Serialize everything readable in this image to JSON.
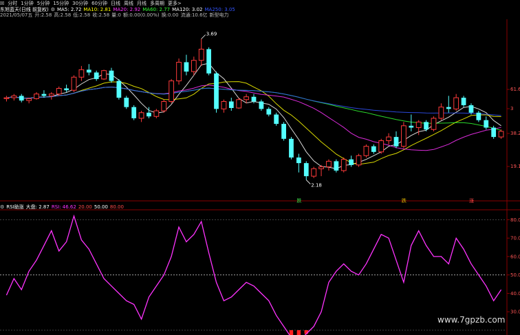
{
  "toolbar": {
    "items": [
      "分时",
      "1分钟",
      "5分钟",
      "15分钟",
      "30分钟",
      "60分钟",
      "日线",
      "周线",
      "月线",
      "多周期",
      "更多>"
    ]
  },
  "legend": {
    "title": "东旭蓝天(日线 前复权)",
    "ma5": "MA5: 2.72",
    "ma10": "MA10: 2.81",
    "ma20": "MA20: 2.92",
    "ma60": "MA60: 2.77",
    "ma120": "MA120: 3.02",
    "ma250": "MA250: 3.05"
  },
  "info": {
    "date": "2021/05/07五",
    "open": "开:2.58",
    "high": "高:2.58",
    "low": "低:2.58",
    "close": "收:2.58",
    "volume": "量:0",
    "amount": "额:0.00(0.00%)",
    "turnover": "换:0.00",
    "float_cap": "流通:10.6亿",
    "concept": "新型电力"
  },
  "annotations": {
    "high": "3.69",
    "low": "2.18"
  },
  "markers": [
    {
      "text": "跌",
      "color": "#3ee04a"
    },
    {
      "text": "跌",
      "color": "#e6b800"
    },
    {
      "text": "涨",
      "color": "#ff4a4a"
    }
  ],
  "price_axis": {
    "labels": [
      "61.6",
      "3",
      "38.2",
      "19.1"
    ]
  },
  "sub_legend": {
    "name": "RSI助涨",
    "market": "大盘: 2.87",
    "rsi": "RSI: 46.62",
    "l20": "20.00",
    "l50": "50.00",
    "l80": "80.00"
  },
  "rsi_axis": {
    "labels": [
      "80.0",
      "70.0",
      "60.0",
      "50.0",
      "40.0",
      "30.0"
    ]
  },
  "colors": {
    "ma5": "#ffffff",
    "ma10": "#ffff00",
    "ma20": "#ff33ff",
    "ma60": "#33ff33",
    "ma120": "#3355ff",
    "ma250": "#ffffff",
    "up": "#ff3b3b",
    "down": "#54ffff",
    "rsi": "#ff33ff",
    "fill": "#ff2020",
    "axis": "#8a0000"
  },
  "watermark": "www.7gpzb.com",
  "chart_data": [
    {
      "type": "candlestick",
      "ylim": [
        2.0,
        3.9
      ],
      "ma_series": [
        "MA5",
        "MA10",
        "MA20",
        "MA60",
        "MA120",
        "MA250"
      ],
      "candles": [
        [
          3.05,
          3.08,
          3.02,
          3.06
        ],
        [
          3.06,
          3.1,
          3.03,
          3.08
        ],
        [
          3.08,
          3.1,
          3.01,
          3.03
        ],
        [
          3.03,
          3.06,
          3.0,
          3.05
        ],
        [
          3.05,
          3.12,
          3.04,
          3.1
        ],
        [
          3.1,
          3.14,
          3.06,
          3.08
        ],
        [
          3.08,
          3.12,
          3.04,
          3.1
        ],
        [
          3.1,
          3.18,
          3.08,
          3.16
        ],
        [
          3.16,
          3.2,
          3.12,
          3.14
        ],
        [
          3.14,
          3.3,
          3.12,
          3.28
        ],
        [
          3.28,
          3.4,
          3.24,
          3.36
        ],
        [
          3.36,
          3.42,
          3.3,
          3.33
        ],
        [
          3.33,
          3.35,
          3.24,
          3.26
        ],
        [
          3.26,
          3.36,
          3.25,
          3.35
        ],
        [
          3.35,
          3.38,
          3.22,
          3.24
        ],
        [
          3.24,
          3.26,
          3.04,
          3.06
        ],
        [
          3.06,
          3.08,
          2.94,
          2.96
        ],
        [
          2.96,
          2.98,
          2.82,
          2.84
        ],
        [
          2.84,
          2.92,
          2.8,
          2.9
        ],
        [
          2.9,
          2.96,
          2.84,
          2.86
        ],
        [
          2.86,
          2.94,
          2.84,
          2.92
        ],
        [
          2.92,
          3.04,
          2.9,
          3.02
        ],
        [
          3.02,
          3.26,
          3.0,
          3.24
        ],
        [
          3.24,
          3.48,
          3.2,
          3.44
        ],
        [
          3.44,
          3.52,
          3.3,
          3.34
        ],
        [
          3.34,
          3.5,
          3.3,
          3.46
        ],
        [
          3.46,
          3.69,
          3.4,
          3.58
        ],
        [
          3.58,
          3.6,
          3.3,
          3.32
        ],
        [
          3.32,
          3.34,
          2.9,
          2.94
        ],
        [
          2.94,
          3.04,
          2.9,
          3.02
        ],
        [
          3.02,
          3.06,
          2.92,
          2.95
        ],
        [
          2.95,
          3.06,
          2.94,
          3.04
        ],
        [
          3.04,
          3.1,
          3.0,
          3.07
        ],
        [
          3.07,
          3.1,
          3.0,
          3.02
        ],
        [
          3.02,
          3.04,
          2.92,
          2.94
        ],
        [
          2.94,
          2.96,
          2.86,
          2.88
        ],
        [
          2.88,
          2.9,
          2.76,
          2.78
        ],
        [
          2.78,
          2.8,
          2.6,
          2.62
        ],
        [
          2.62,
          2.64,
          2.4,
          2.42
        ],
        [
          2.42,
          2.46,
          2.26,
          2.36
        ],
        [
          2.36,
          2.38,
          2.18,
          2.22
        ],
        [
          2.22,
          2.32,
          2.2,
          2.3
        ],
        [
          2.3,
          2.34,
          2.22,
          2.32
        ],
        [
          2.32,
          2.4,
          2.28,
          2.38
        ],
        [
          2.38,
          2.4,
          2.26,
          2.28
        ],
        [
          2.28,
          2.42,
          2.26,
          2.4
        ],
        [
          2.4,
          2.44,
          2.32,
          2.34
        ],
        [
          2.34,
          2.46,
          2.32,
          2.44
        ],
        [
          2.44,
          2.56,
          2.42,
          2.54
        ],
        [
          2.54,
          2.56,
          2.46,
          2.48
        ],
        [
          2.48,
          2.62,
          2.46,
          2.6
        ],
        [
          2.6,
          2.68,
          2.56,
          2.64
        ],
        [
          2.64,
          2.7,
          2.52,
          2.54
        ],
        [
          2.54,
          2.8,
          2.52,
          2.76
        ],
        [
          2.76,
          2.88,
          2.7,
          2.74
        ],
        [
          2.74,
          2.82,
          2.66,
          2.8
        ],
        [
          2.8,
          2.82,
          2.7,
          2.72
        ],
        [
          2.72,
          2.86,
          2.7,
          2.84
        ],
        [
          2.84,
          3.0,
          2.82,
          2.96
        ],
        [
          2.96,
          3.08,
          2.9,
          2.94
        ],
        [
          2.94,
          3.1,
          2.92,
          3.06
        ],
        [
          3.06,
          3.08,
          2.96,
          2.98
        ],
        [
          2.98,
          3.0,
          2.88,
          2.9
        ],
        [
          2.9,
          2.92,
          2.8,
          2.82
        ],
        [
          2.82,
          2.86,
          2.72,
          2.74
        ],
        [
          2.74,
          2.76,
          2.62,
          2.64
        ],
        [
          2.64,
          2.72,
          2.62,
          2.7
        ]
      ]
    },
    {
      "type": "line",
      "title": "RSI助涨",
      "ylim": [
        20,
        85
      ],
      "reference_lines": [
        20,
        50,
        80
      ],
      "series": [
        {
          "name": "RSI",
          "values": [
            39,
            48,
            42,
            52,
            58,
            66,
            74,
            63,
            68,
            82,
            69,
            64,
            56,
            48,
            44,
            40,
            36,
            34,
            26,
            38,
            44,
            50,
            60,
            76,
            68,
            72,
            79,
            62,
            46,
            36,
            38,
            42,
            46,
            44,
            40,
            36,
            28,
            22,
            16,
            14,
            18,
            22,
            30,
            46,
            52,
            56,
            52,
            50,
            56,
            64,
            72,
            70,
            58,
            46,
            66,
            74,
            66,
            60,
            60,
            56,
            70,
            64,
            56,
            50,
            44,
            36,
            42
          ]
        }
      ],
      "below_20_fill_color": "#ff2020"
    }
  ]
}
